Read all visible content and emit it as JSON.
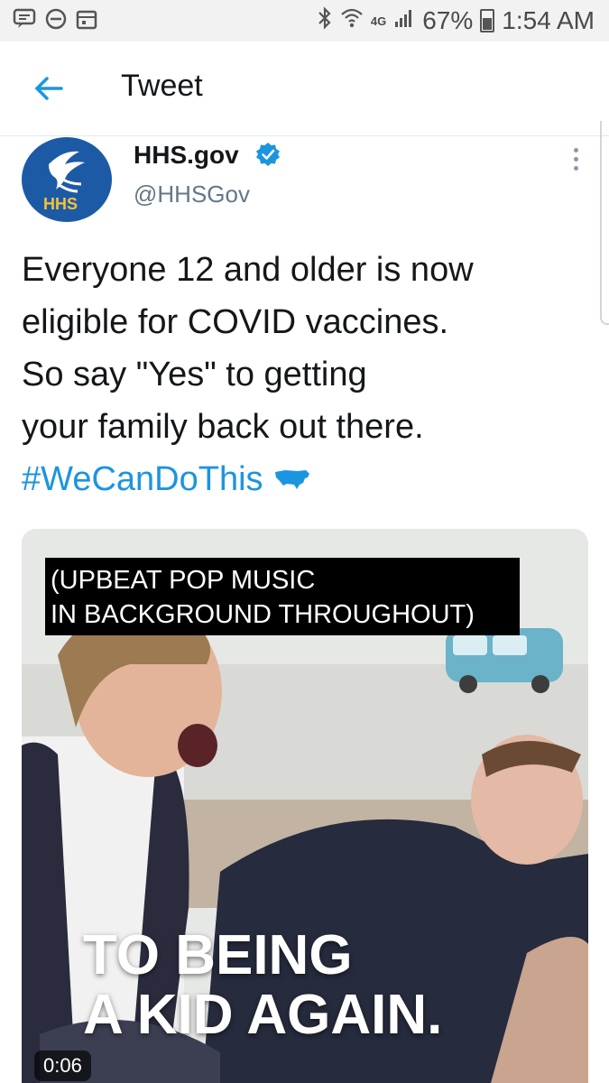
{
  "status_bar": {
    "left_icons": [
      "message-icon",
      "do-not-disturb-icon",
      "calendar-icon"
    ],
    "right_icons": [
      "bluetooth-icon",
      "wifi-icon",
      "network-4g-icon",
      "signal-icon",
      "battery-icon"
    ],
    "network_label": "4G",
    "battery": "67%",
    "time": "1:54 AM"
  },
  "header": {
    "back_icon": "arrow-left-icon",
    "title": "Tweet",
    "accent": "#1b95e0"
  },
  "tweet": {
    "author": {
      "display_name": "HHS.gov",
      "handle": "@HHSGov",
      "verified": true,
      "avatar_text": "HHS"
    },
    "text_lines": [
      "Everyone 12 and older is now",
      "eligible for COVID vaccines.",
      "So say \"Yes\" to getting",
      "your family back out there."
    ],
    "hashtag": "#WeCanDoThis",
    "hashtag_emoji": "us-map-icon",
    "media": {
      "caption_lines": [
        "(UPBEAT POP MUSIC",
        "IN BACKGROUND THROUGHOUT)"
      ],
      "overlay_lines": [
        "TO BEING",
        "A KID AGAIN."
      ],
      "timestamp": "0:06"
    }
  }
}
